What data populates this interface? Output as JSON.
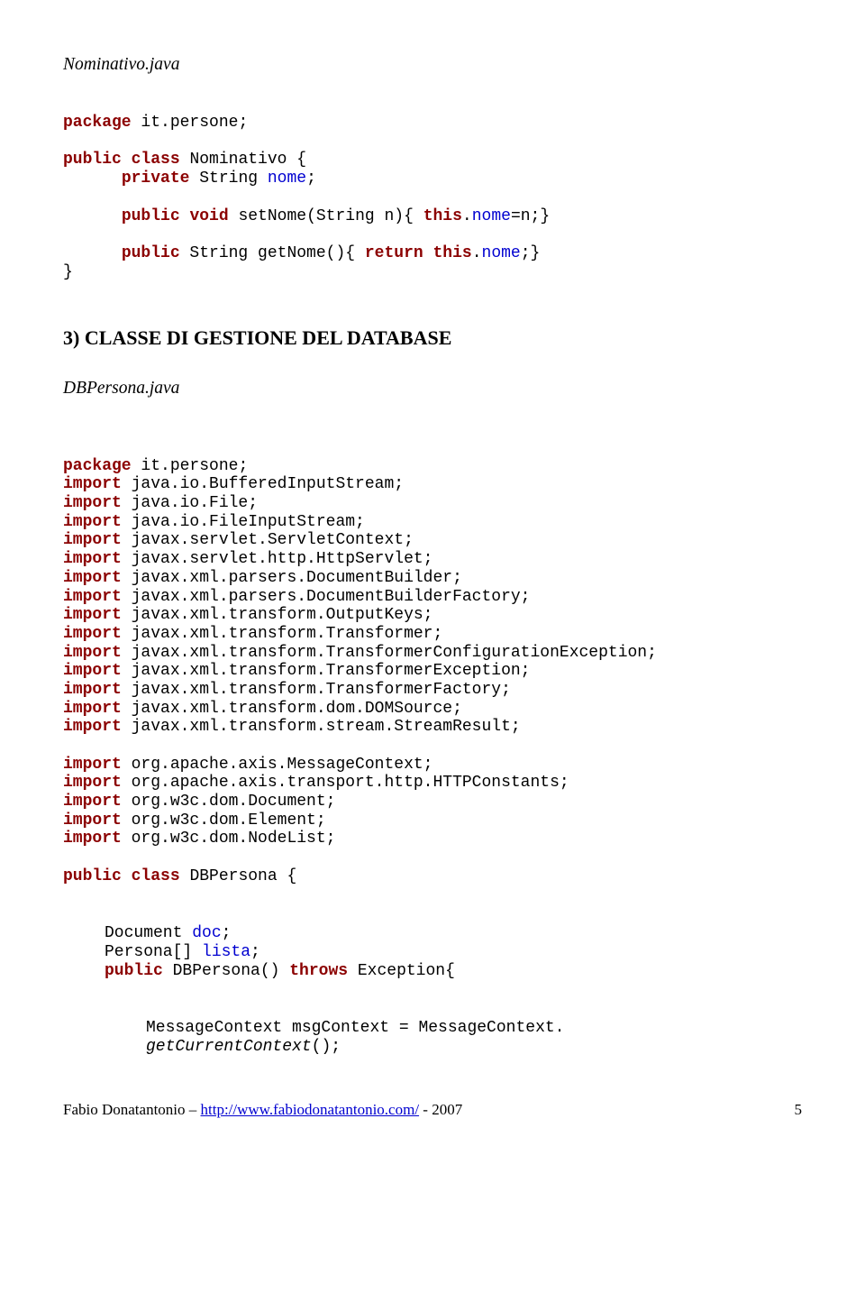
{
  "file1": "Nominativo.java",
  "code1": {
    "l1": {
      "kw1": "package",
      "rest": " it.persone;"
    },
    "l2": {
      "kw1": "public",
      "kw2": "class",
      "rest1": " ",
      "name": " Nominativo {"
    },
    "l3": {
      "kw1": "private",
      "rest": " String ",
      "var": "nome",
      "semi": ";"
    },
    "l4": {
      "kw1": "public",
      "kw2": "void",
      "rest1": " ",
      "rest2": " setNome(String n){ ",
      "kw3": "this",
      "rest3": ".",
      "var": "nome",
      "rest4": "=n;}"
    },
    "l5": {
      "kw1": "public",
      "rest1": " String getNome(){ ",
      "kw2": "return",
      "kw3": "this",
      "rest2": " ",
      "rest3": ".",
      "var": "nome",
      "rest4": ";}"
    },
    "l6": "}"
  },
  "sectionTitle": "3) CLASSE DI GESTIONE DEL DATABASE",
  "file2": "DBPersona.java",
  "code2": {
    "pkg": {
      "kw": "package",
      "rest": " it.persone;"
    },
    "imports": [
      {
        "kw": "import",
        "rest": " java.io.BufferedInputStream;"
      },
      {
        "kw": "import",
        "rest": " java.io.File;"
      },
      {
        "kw": "import",
        "rest": " java.io.FileInputStream;"
      },
      {
        "kw": "import",
        "rest": " javax.servlet.ServletContext;"
      },
      {
        "kw": "import",
        "rest": " javax.servlet.http.HttpServlet;"
      },
      {
        "kw": "import",
        "rest": " javax.xml.parsers.DocumentBuilder;"
      },
      {
        "kw": "import",
        "rest": " javax.xml.parsers.DocumentBuilderFactory;"
      },
      {
        "kw": "import",
        "rest": " javax.xml.transform.OutputKeys;"
      },
      {
        "kw": "import",
        "rest": " javax.xml.transform.Transformer;"
      },
      {
        "kw": "import",
        "rest": " javax.xml.transform.TransformerConfigurationException;"
      },
      {
        "kw": "import",
        "rest": " javax.xml.transform.TransformerException;"
      },
      {
        "kw": "import",
        "rest": " javax.xml.transform.TransformerFactory;"
      },
      {
        "kw": "import",
        "rest": " javax.xml.transform.dom.DOMSource;"
      },
      {
        "kw": "import",
        "rest": " javax.xml.transform.stream.StreamResult;"
      }
    ],
    "imports2": [
      {
        "kw": "import",
        "rest": " org.apache.axis.MessageContext;"
      },
      {
        "kw": "import",
        "rest": " org.apache.axis.transport.http.HTTPConstants;"
      },
      {
        "kw": "import",
        "rest": " org.w3c.dom.Document;"
      },
      {
        "kw": "import",
        "rest": " org.w3c.dom.Element;"
      },
      {
        "kw": "import",
        "rest": " org.w3c.dom.NodeList;"
      }
    ],
    "classLine": {
      "kw1": "public",
      "kw2": "class",
      "rest1": " ",
      "name": " DBPersona {"
    },
    "body": {
      "l1": {
        "t1": "Document ",
        "var": "doc",
        "t2": ";"
      },
      "l2": {
        "t1": "Persona[] ",
        "var": "lista",
        "t2": ";"
      },
      "l3": {
        "kw1": "public",
        "t1": " DBPersona() ",
        "kw2": "throws",
        "t2": " Exception{"
      },
      "l4": {
        "t1": "MessageContext msgContext = MessageContext."
      },
      "l5": {
        "m": "getCurrentContext",
        "t": "();"
      }
    }
  },
  "footer": {
    "left": "Fabio Donatantonio – ",
    "link": "http://www.fabiodonatantonio.com/",
    "right": " - 2007",
    "page": "5"
  }
}
